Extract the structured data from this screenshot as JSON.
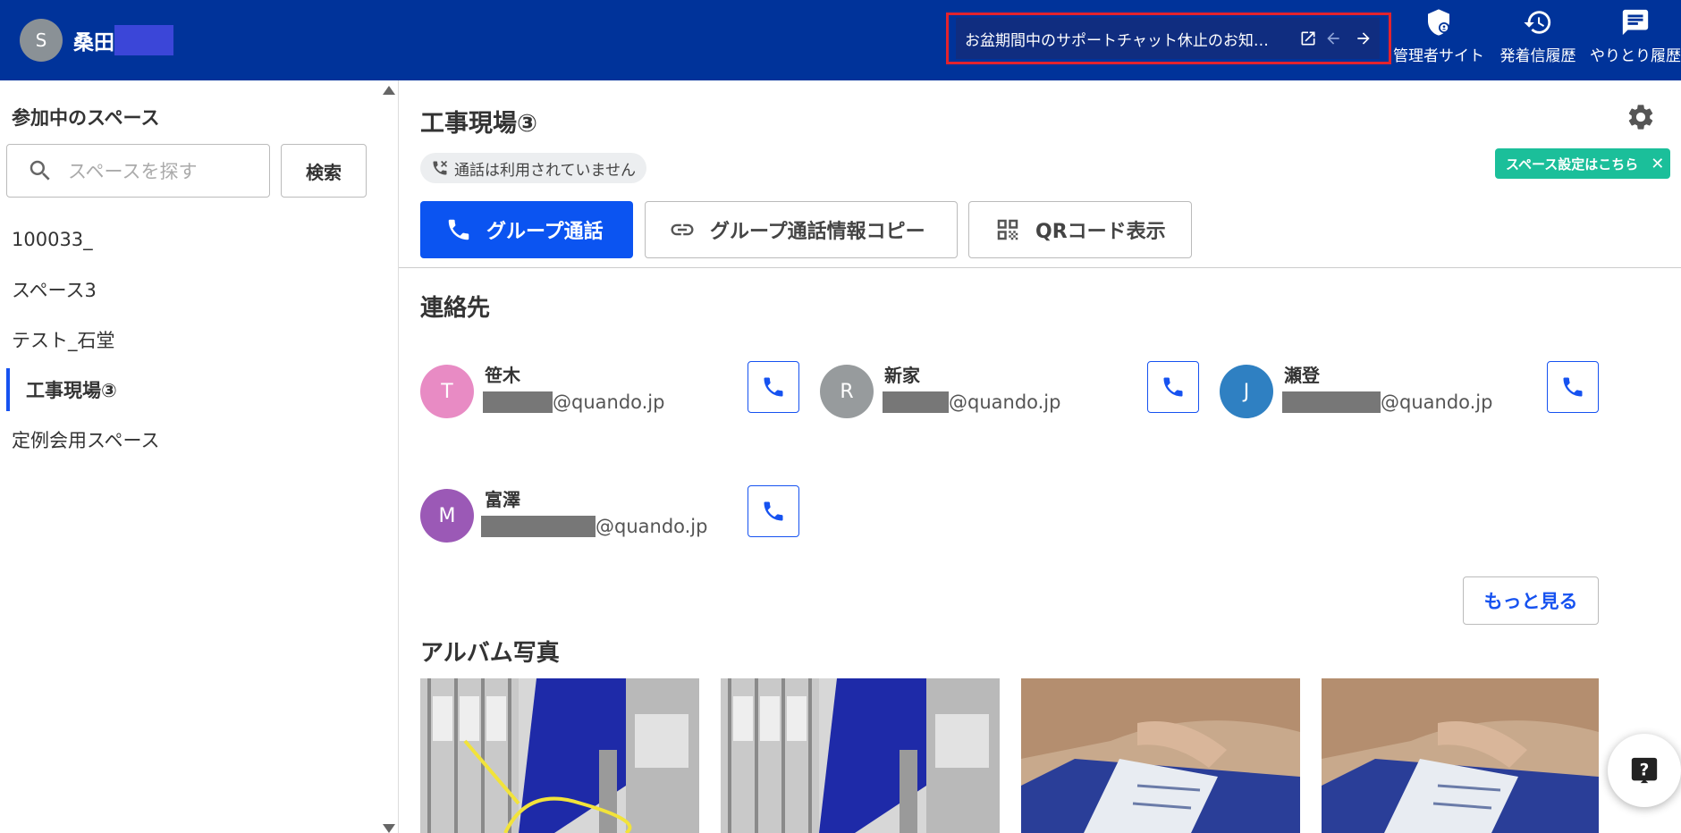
{
  "header": {
    "user_initial": "S",
    "user_name": "桑田",
    "notice_text": "お盆期間中のサポートチャット休止のお知…",
    "nav": [
      {
        "label": "管理者サイト",
        "icon": "admin-shield-icon"
      },
      {
        "label": "発着信履歴",
        "icon": "history-icon"
      },
      {
        "label": "やりとり履歴",
        "icon": "chat-icon"
      }
    ]
  },
  "sidebar": {
    "title": "参加中のスペース",
    "search_placeholder": "スペースを探す",
    "search_button": "検索",
    "spaces": [
      {
        "label": "100033_"
      },
      {
        "label": "スペース3"
      },
      {
        "label": "テスト_石堂"
      },
      {
        "label": "工事現場③",
        "active": true
      },
      {
        "label": "定例会用スペース"
      }
    ]
  },
  "main": {
    "title": "工事現場③",
    "call_status": "通話は利用されていません",
    "settings_tip": "スペース設定はこちら",
    "settings_tip_close": "✕",
    "buttons": {
      "group_call": "グループ通話",
      "copy_info": "グループ通話情報コピー",
      "qr": "QRコード表示"
    },
    "contacts_title": "連絡先",
    "contacts": [
      {
        "initial": "T",
        "name": "笹木",
        "email_domain": "@quando.jp",
        "color": "#e88bc4"
      },
      {
        "initial": "R",
        "name": "新家",
        "email_domain": "@quando.jp",
        "color": "#979b9d"
      },
      {
        "initial": "J",
        "name": "瀬登",
        "email_domain": "@quando.jp",
        "color": "#2f80c2"
      },
      {
        "initial": "M",
        "name": "富澤",
        "email_domain": "@quando.jp",
        "color": "#9b59b6"
      }
    ],
    "more_button": "もっと見る",
    "album_title": "アルバム写真"
  },
  "colors": {
    "header_bg": "#00339a",
    "primary": "#0b54f1",
    "tip": "#1bbf9a",
    "notice_border": "#e2232e"
  }
}
